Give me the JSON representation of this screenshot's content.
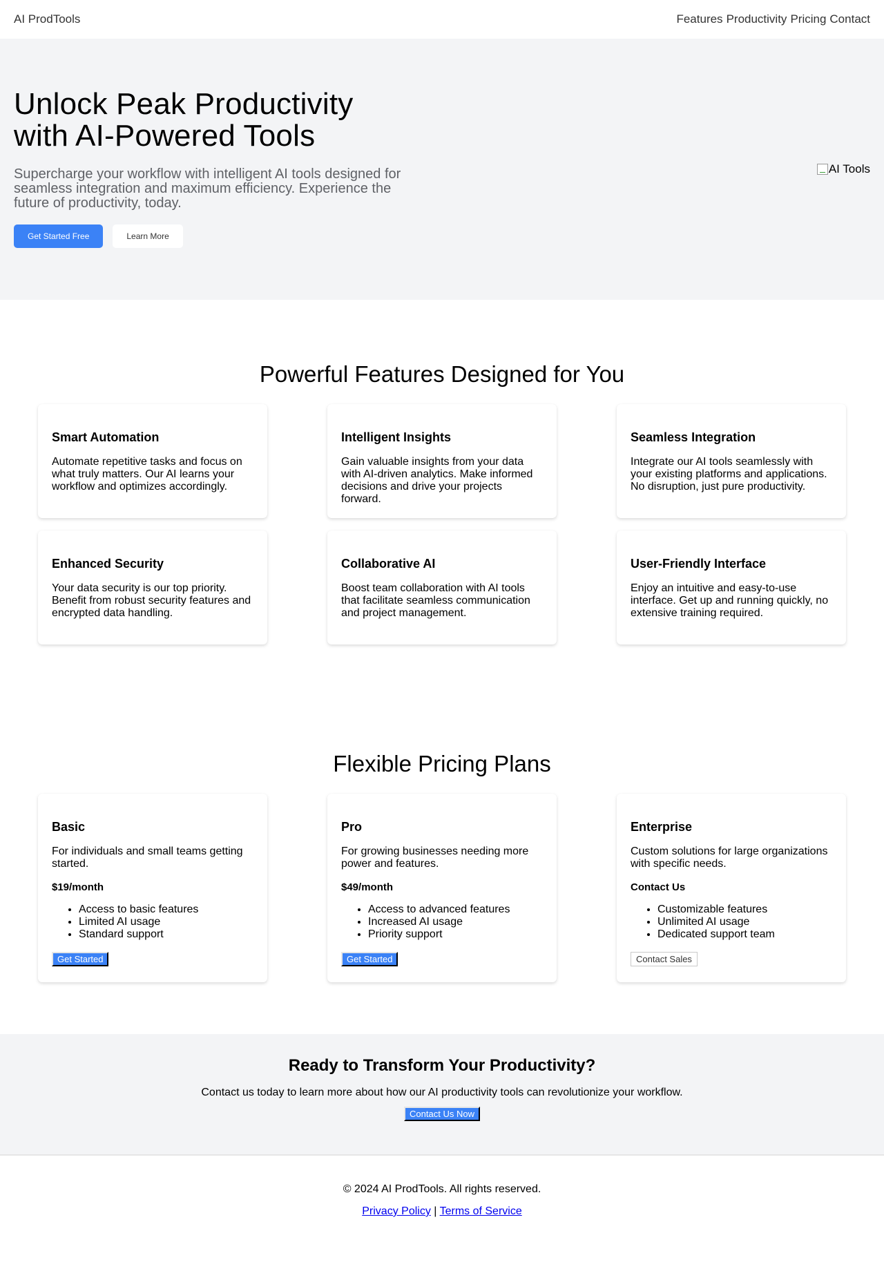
{
  "nav": {
    "brand": "AI ProdTools",
    "links": [
      "Features",
      "Productivity",
      "Pricing",
      "Contact"
    ]
  },
  "hero": {
    "title": "Unlock Peak Productivity with AI-Powered Tools",
    "subtitle": "Supercharge your workflow with intelligent AI tools designed for seamless integration and maximum efficiency. Experience the future of productivity, today.",
    "primary_button": "Get Started Free",
    "secondary_button": "Learn More",
    "image_alt": "AI Tools"
  },
  "features": {
    "title": "Powerful Features Designed for You",
    "items": [
      {
        "title": "Smart Automation",
        "text": "Automate repetitive tasks and focus on what truly matters. Our AI learns your workflow and optimizes accordingly."
      },
      {
        "title": "Intelligent Insights",
        "text": "Gain valuable insights from your data with AI-driven analytics. Make informed decisions and drive your projects forward."
      },
      {
        "title": "Seamless Integration",
        "text": "Integrate our AI tools seamlessly with your existing platforms and applications. No disruption, just pure productivity."
      },
      {
        "title": "Enhanced Security",
        "text": "Your data security is our top priority. Benefit from robust security features and encrypted data handling."
      },
      {
        "title": "Collaborative AI",
        "text": "Boost team collaboration with AI tools that facilitate seamless communication and project management."
      },
      {
        "title": "User-Friendly Interface",
        "text": "Enjoy an intuitive and easy-to-use interface. Get up and running quickly, no extensive training required."
      }
    ]
  },
  "pricing": {
    "title": "Flexible Pricing Plans",
    "plans": [
      {
        "name": "Basic",
        "description": "For individuals and small teams getting started.",
        "price": "$19/month",
        "features": [
          "Access to basic features",
          "Limited AI usage",
          "Standard support"
        ],
        "button": "Get Started"
      },
      {
        "name": "Pro",
        "description": "For growing businesses needing more power and features.",
        "price": "$49/month",
        "features": [
          "Access to advanced features",
          "Increased AI usage",
          "Priority support"
        ],
        "button": "Get Started"
      },
      {
        "name": "Enterprise",
        "description": "Custom solutions for large organizations with specific needs.",
        "price": "Contact Us",
        "features": [
          "Customizable features",
          "Unlimited AI usage",
          "Dedicated support team"
        ],
        "button": "Contact Sales"
      }
    ]
  },
  "cta": {
    "title": "Ready to Transform Your Productivity?",
    "text": "Contact us today to learn more about how our AI productivity tools can revolutionize your workflow.",
    "button": "Contact Us Now"
  },
  "footer": {
    "copyright": "© 2024 AI ProdTools. All rights reserved.",
    "privacy": "Privacy Policy",
    "separator": "|",
    "terms": "Terms of Service"
  },
  "colors": {
    "accent": "#3b82f6",
    "section_bg": "#f3f4f6",
    "subtitle_text": "#5f6166"
  }
}
